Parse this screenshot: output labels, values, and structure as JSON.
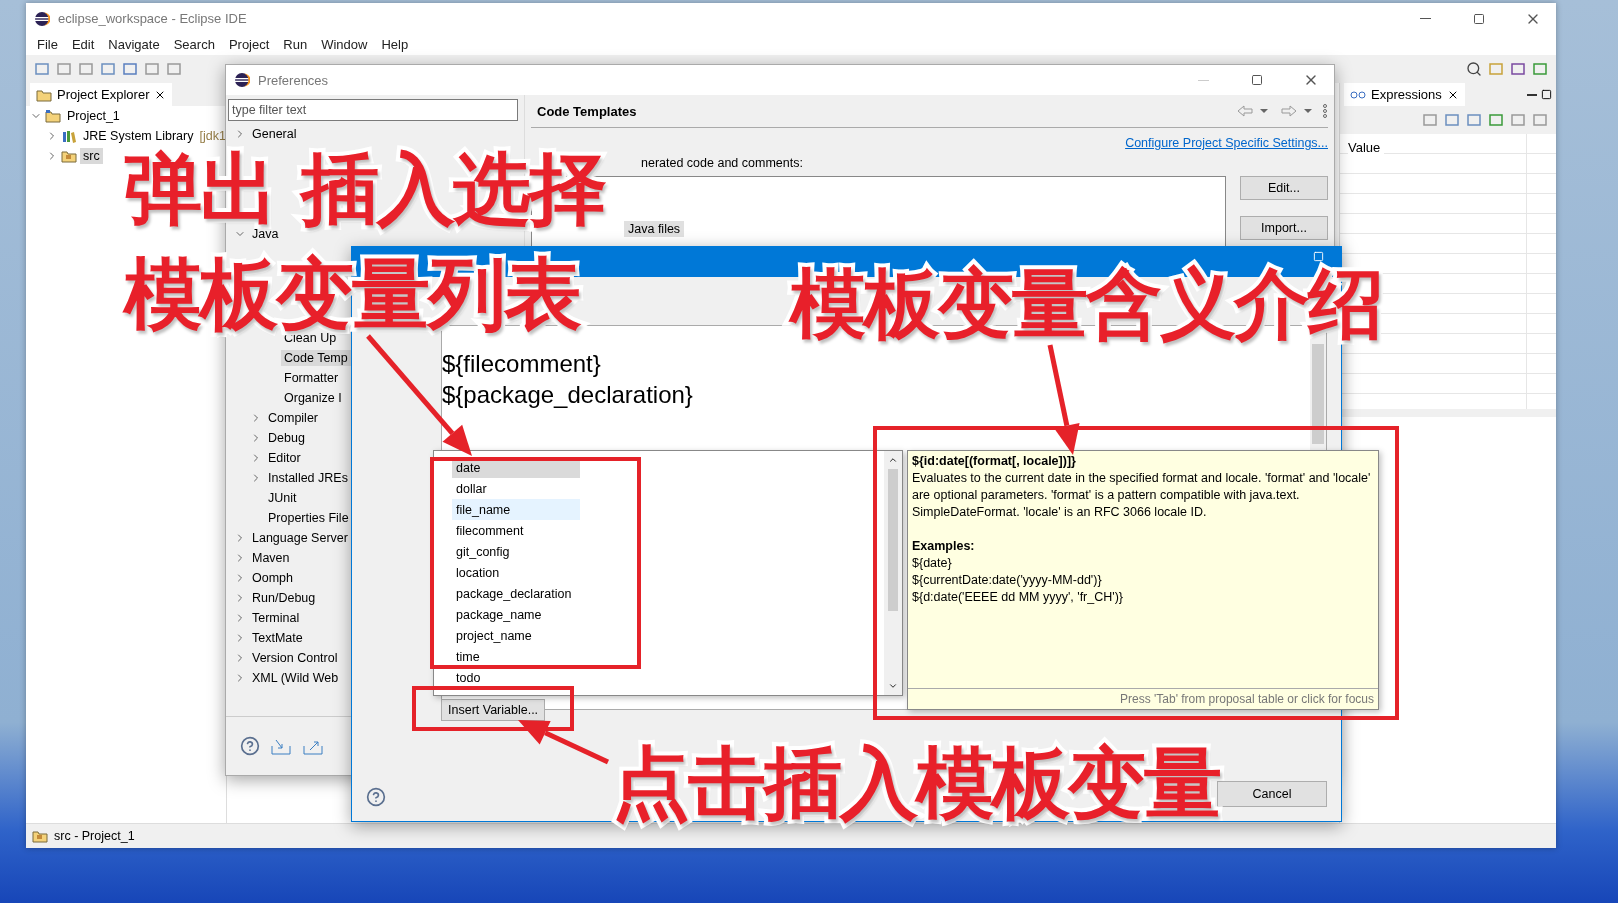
{
  "window": {
    "title": "eclipse_workspace - Eclipse IDE"
  },
  "menu": [
    "File",
    "Edit",
    "Navigate",
    "Search",
    "Project",
    "Run",
    "Window",
    "Help"
  ],
  "project_explorer": {
    "tab": "Project Explorer",
    "tree": [
      {
        "label": "Project_1",
        "kind": "project",
        "expanded": true,
        "selected": false,
        "children": [
          {
            "label": "JRE System Library",
            "decoration": "[jdk1",
            "kind": "library",
            "expanded": false,
            "selected": false
          },
          {
            "label": "src",
            "kind": "source",
            "expanded": false,
            "selected": true
          }
        ]
      }
    ]
  },
  "expressions": {
    "tab": "Expressions",
    "column": "Value"
  },
  "status_bar": "src - Project_1",
  "preferences": {
    "title": "Preferences",
    "filter_placeholder": "type filter text",
    "tree": [
      {
        "label": "General",
        "kind": "node",
        "expanded": false,
        "selected": false
      },
      {
        "label": "Java",
        "kind": "node",
        "expanded": true,
        "selected": false,
        "children": [
          {
            "kind": "group",
            "children": [
              {
                "label": "Clean Up",
                "kind": "leaf",
                "selected": false
              },
              {
                "label": "Code Temp",
                "kind": "leaf",
                "selected": true
              },
              {
                "label": "Formatter",
                "kind": "leaf",
                "selected": false
              },
              {
                "label": "Organize I",
                "kind": "leaf",
                "selected": false
              }
            ]
          },
          {
            "label": "Compiler",
            "kind": "node",
            "expanded": false,
            "selected": false
          },
          {
            "label": "Debug",
            "kind": "node",
            "expanded": false,
            "selected": false
          },
          {
            "label": "Editor",
            "kind": "node",
            "expanded": false,
            "selected": false
          },
          {
            "label": "Installed JREs",
            "kind": "node",
            "expanded": false,
            "selected": false
          },
          {
            "label": "JUnit",
            "kind": "leaf",
            "selected": false
          },
          {
            "label": "Properties File",
            "kind": "leaf",
            "selected": false
          }
        ]
      },
      {
        "label": "Language Server",
        "kind": "node",
        "expanded": false,
        "selected": false
      },
      {
        "label": "Maven",
        "kind": "node",
        "expanded": false,
        "selected": false
      },
      {
        "label": "Oomph",
        "kind": "node",
        "expanded": false,
        "selected": false
      },
      {
        "label": "Run/Debug",
        "kind": "node",
        "expanded": false,
        "selected": false
      },
      {
        "label": "Terminal",
        "kind": "node",
        "expanded": false,
        "selected": false
      },
      {
        "label": "TextMate",
        "kind": "node",
        "expanded": false,
        "selected": false
      },
      {
        "label": "Version Control",
        "kind": "node",
        "expanded": false,
        "selected": false
      },
      {
        "label": "XML (Wild Web",
        "kind": "node",
        "expanded": false,
        "selected": false
      }
    ],
    "page_title": "Code Templates",
    "link": "Configure Project Specific Settings...",
    "list_label": "nerated code and comments:",
    "list_item": "Java files",
    "buttons": [
      "Edit...",
      "Import..."
    ]
  },
  "edit_template": {
    "pattern_lines": [
      "${filecomment}",
      "${package_declaration}"
    ],
    "insert_button": "Insert Variable...",
    "cancel_button": "Cancel"
  },
  "proposals": [
    {
      "label": "date",
      "selected": true,
      "hovered": false
    },
    {
      "label": "dollar",
      "selected": false,
      "hovered": false
    },
    {
      "label": "file_name",
      "selected": false,
      "hovered": true
    },
    {
      "label": "filecomment",
      "selected": false,
      "hovered": false
    },
    {
      "label": "git_config",
      "selected": false,
      "hovered": false
    },
    {
      "label": "location",
      "selected": false,
      "hovered": false
    },
    {
      "label": "package_declaration",
      "selected": false,
      "hovered": false
    },
    {
      "label": "package_name",
      "selected": false,
      "hovered": false
    },
    {
      "label": "project_name",
      "selected": false,
      "hovered": false
    },
    {
      "label": "time",
      "selected": false,
      "hovered": false
    },
    {
      "label": "todo",
      "selected": false,
      "hovered": false
    }
  ],
  "info": {
    "signature": "${id:date[(format[, locale])]}",
    "description": "Evaluates to the current date in the specified format and locale. 'format' and 'locale' are optional parameters. 'format' is a pattern compatible with java.text. SimpleDateFormat. 'locale' is an RFC 3066 locale ID.",
    "examples_heading": "Examples:",
    "examples": [
      "${date}",
      "${currentDate:date('yyyy-MM-dd')}",
      "${d:date('EEEE dd MM yyyy', 'fr_CH')}"
    ],
    "footer": "Press 'Tab' from proposal table or click for focus"
  },
  "annotations": [
    {
      "text": "弹出 插入选择"
    },
    {
      "text": "模板变量列表"
    },
    {
      "text": "模板变量含义介绍"
    },
    {
      "text": "点击插入模板变量"
    }
  ]
}
